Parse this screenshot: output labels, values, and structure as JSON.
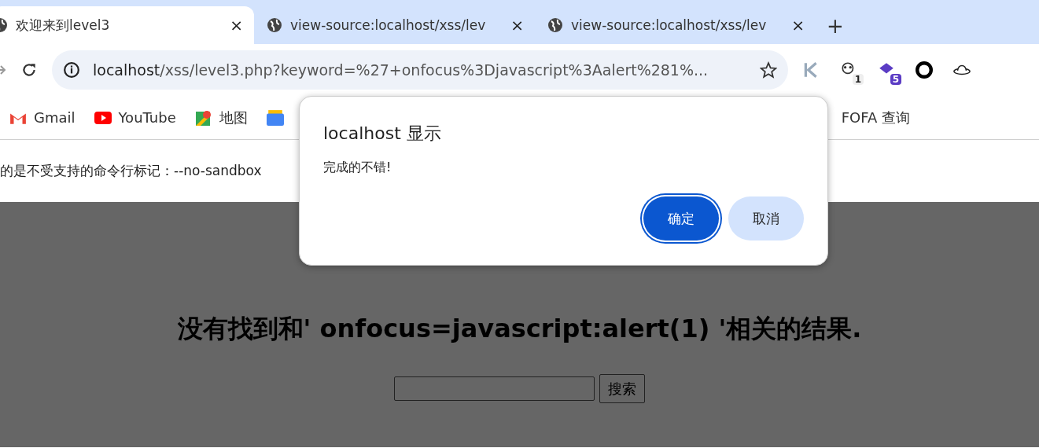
{
  "tabs": [
    {
      "title": "欢迎来到level3",
      "selected": true,
      "close": "×"
    },
    {
      "title": "view-source:localhost/xss/lev",
      "selected": false,
      "close": "×"
    },
    {
      "title": "view-source:localhost/xss/lev",
      "selected": false,
      "close": "×"
    }
  ],
  "new_tab": "+",
  "address_bar": {
    "host": "localhost",
    "path": "/xss/level3.php?keyword=%27+onfocus%3Djavascript%3Aalert%281%..."
  },
  "extensions": [
    {
      "kind": "k"
    },
    {
      "kind": "panda",
      "badge": "1"
    },
    {
      "kind": "cube",
      "badge": "5"
    },
    {
      "kind": "ring"
    },
    {
      "kind": "hat"
    }
  ],
  "bookmarks": [
    {
      "kind": "gmail",
      "label": "Gmail"
    },
    {
      "kind": "youtube",
      "label": "YouTube"
    },
    {
      "kind": "maps",
      "label": "地图"
    },
    {
      "kind": "news"
    },
    {
      "kind": "plain",
      "label": "FOFA 查询"
    }
  ],
  "info_bar": "的是不受支持的命令行标记：--no-sandbox",
  "page": {
    "heading": "没有找到和' onfocus=javascript:alert(1) '相关的结果.",
    "search_button": "搜索"
  },
  "dialog": {
    "title": "localhost 显示",
    "message": "完成的不错!",
    "buttons": [
      {
        "label": "确定",
        "selected": true
      },
      {
        "label": "取消",
        "selected": false
      }
    ]
  }
}
